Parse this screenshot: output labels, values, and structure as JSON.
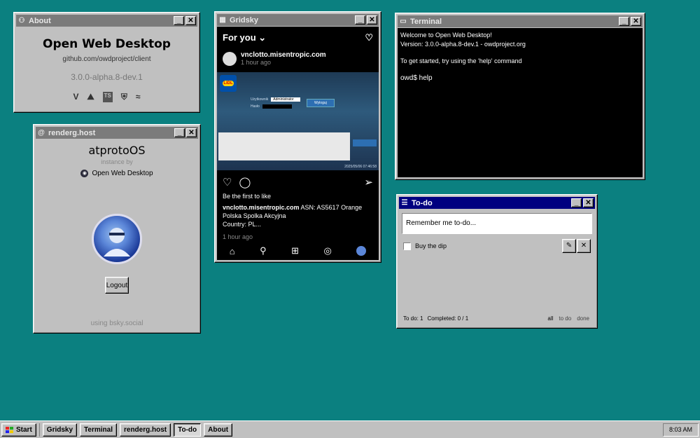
{
  "about": {
    "title": "About",
    "heading": "Open Web Desktop",
    "link": "github.com/owdproject/client",
    "version": "3.0.0-alpha.8-dev.1",
    "tech_icons": [
      "V",
      "⛰",
      "TS",
      "⛨",
      "≈"
    ]
  },
  "renderg": {
    "title": "renderg.host",
    "app_name": "atprotoOS",
    "instance_by": "instance by",
    "instance_name": "Open Web Desktop",
    "logout_label": "Logout",
    "using": "using bsky.social"
  },
  "gridsky": {
    "title": "Gridsky",
    "feed_label": "For you ⌄",
    "post_user": "vnclotto.misentropic.com",
    "post_time": "1 hour ago",
    "image_brand": "LIDL",
    "image_fields": [
      "Użytkownik",
      "Hasło"
    ],
    "image_select": "Administrator",
    "image_button": "Wyloguj",
    "image_timestamp": "2025/05/06 07:46:58",
    "likes_text": "Be the first to like",
    "caption_user": "vnclotto.misentropic.com",
    "caption_text": " ASN: AS5617 Orange Polska Spolka Akcyjna",
    "caption_country": "Country: PL...",
    "caption_time": "1 hour ago"
  },
  "terminal": {
    "title": "Terminal",
    "lines": [
      "Welcome to Open Web Desktop!",
      "Version: 3.0.0-alpha.8-dev.1 - owdproject.org",
      "",
      "To get started, try using the 'help' command",
      "",
      "owd$ help"
    ]
  },
  "todo": {
    "title": "To-do",
    "input_placeholder": "Remember me to-do...",
    "items": [
      {
        "label": "Buy the dip",
        "done": false
      }
    ],
    "footer": {
      "todo_count": "To do: 1",
      "completed": "Completed: 0 / 1",
      "filter_all": "all",
      "filter_todo": "to do",
      "filter_done": "done"
    }
  },
  "taskbar": {
    "start_label": "Start",
    "tasks": [
      "Gridsky",
      "Terminal",
      "renderg.host",
      "To-do",
      "About"
    ],
    "clock": "8:03 AM"
  }
}
